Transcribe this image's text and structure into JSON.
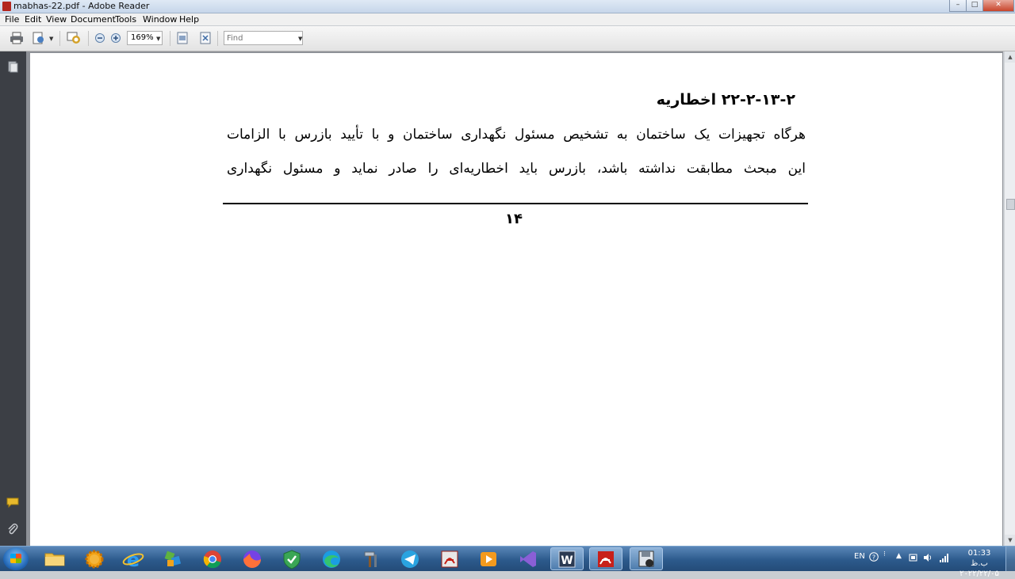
{
  "window": {
    "title": "mabhas-22.pdf - Adobe Reader",
    "controls": [
      "minimize",
      "maximize",
      "close"
    ]
  },
  "menu": [
    "File",
    "Edit",
    "View",
    "Document",
    "Tools",
    "Window",
    "Help"
  ],
  "toolbar": {
    "zoom": "169%",
    "find_placeholder": "Find"
  },
  "document": {
    "heading": "۲۲-۲-۱۳-۲ اخطاریه",
    "lines": [
      "هرگاه تجهیزات یک ساختمان به تشخیص مسئول نگهداری ساختمان و با تأیید بازرس با الزامات",
      "این مبحث مطابقت نداشته باشد، بازرس باید اخطاریه‌ای را صادر نماید و مسئول نگهداری"
    ],
    "page_number": "۱۴"
  },
  "taskbar": {
    "language": "EN",
    "time": "01:33 ب.ظ",
    "date": "۲۰۲۲/۲۲/۰۵",
    "apps": [
      "file-explorer",
      "settings",
      "internet-explorer",
      "tool-app",
      "chrome",
      "firefox",
      "security-app",
      "edge",
      "tools-app",
      "telegram",
      "acrobat-pro",
      "media-player",
      "visual-studio",
      "word",
      "adobe-reader",
      "save-app"
    ]
  }
}
